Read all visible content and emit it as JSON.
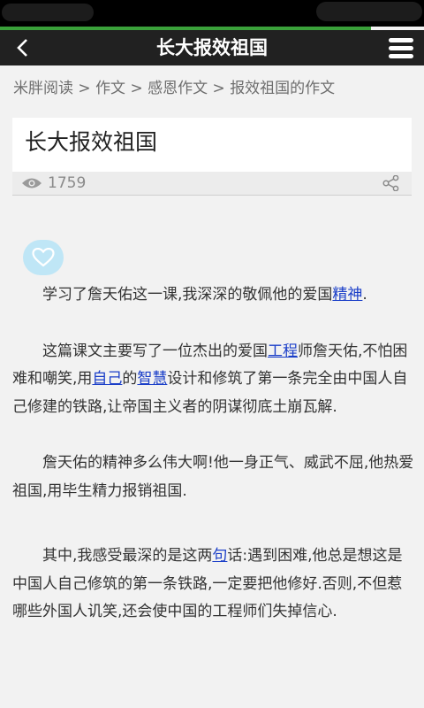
{
  "header": {
    "title": "长大报效祖国"
  },
  "breadcrumb": [
    "米胖阅读",
    "作文",
    "感恩作文",
    "报效祖国的作文"
  ],
  "breadcrumb_sep": ">",
  "article": {
    "title": "长大报效祖国",
    "views": "1759",
    "paragraphs": [
      [
        {
          "t": "学习了詹天佑这一课,我深深的敬佩他的爱国"
        },
        {
          "t": "精神",
          "link": true
        },
        {
          "t": "."
        }
      ],
      [
        {
          "t": "这篇课文主要写了一位杰出的爱国"
        },
        {
          "t": "工程",
          "link": true
        },
        {
          "t": "师詹天佑,不怕困难和嘲笑,用"
        },
        {
          "t": "自己",
          "link": true
        },
        {
          "t": "的"
        },
        {
          "t": "智慧",
          "link": true
        },
        {
          "t": "设计和修筑了第一条完全由中国人自己修建的铁路,让帝国主义者的阴谋彻底土崩瓦解."
        }
      ],
      [
        {
          "t": "詹天佑的精神多么伟大啊!他一身正气、威武不屈,他热爱祖国,用毕生精力报销祖国."
        }
      ],
      [
        {
          "t": "其中,我感受最深的是这两"
        },
        {
          "t": "句",
          "link": true
        },
        {
          "t": "话:遇到困难,他总是想这是中国人自己修筑的第一条铁路,一定要把他修好.否则,不但惹哪些外国人讥笑,还会使中国的工程师们失掉信心."
        }
      ]
    ]
  },
  "colors": {
    "accent": "#3aa13a",
    "topbar": "#212121",
    "link": "#1a3ec8",
    "heart_bg": "#bfe6f6"
  },
  "icons": {
    "back": "chevron-left-icon",
    "menu": "hamburger-menu-icon",
    "views": "eye-icon",
    "share": "share-icon",
    "like": "heart-icon"
  }
}
